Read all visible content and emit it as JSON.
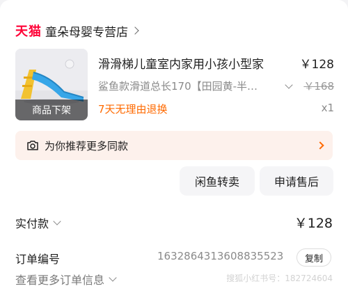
{
  "store": {
    "brand": "天猫",
    "name": "童朵母婴专营店"
  },
  "product": {
    "title": "滑滑梯儿童室内家用小孩小型家",
    "price": "￥128",
    "sku": "鲨鱼款滑道总长170【田园黄-半…",
    "original_price": "￥168",
    "return_policy": "7天无理由退换",
    "quantity": "x1",
    "status_overlay": "商品下架"
  },
  "recommend": {
    "label": "为你推荐更多同款"
  },
  "actions": {
    "resell": "闲鱼转卖",
    "after_sale": "申请售后"
  },
  "payment": {
    "label": "实付款",
    "value": "￥128"
  },
  "order": {
    "number_label": "订单编号",
    "number_value": "1632864313608835523",
    "copy_label": "复制",
    "more_info": "查看更多订单信息"
  },
  "watermark": "搜狐小红书号：182724604",
  "colors": {
    "brand_red": "#ff0036",
    "accent_orange": "#ff6a00",
    "recommend_bg": "#fdf1ec"
  }
}
